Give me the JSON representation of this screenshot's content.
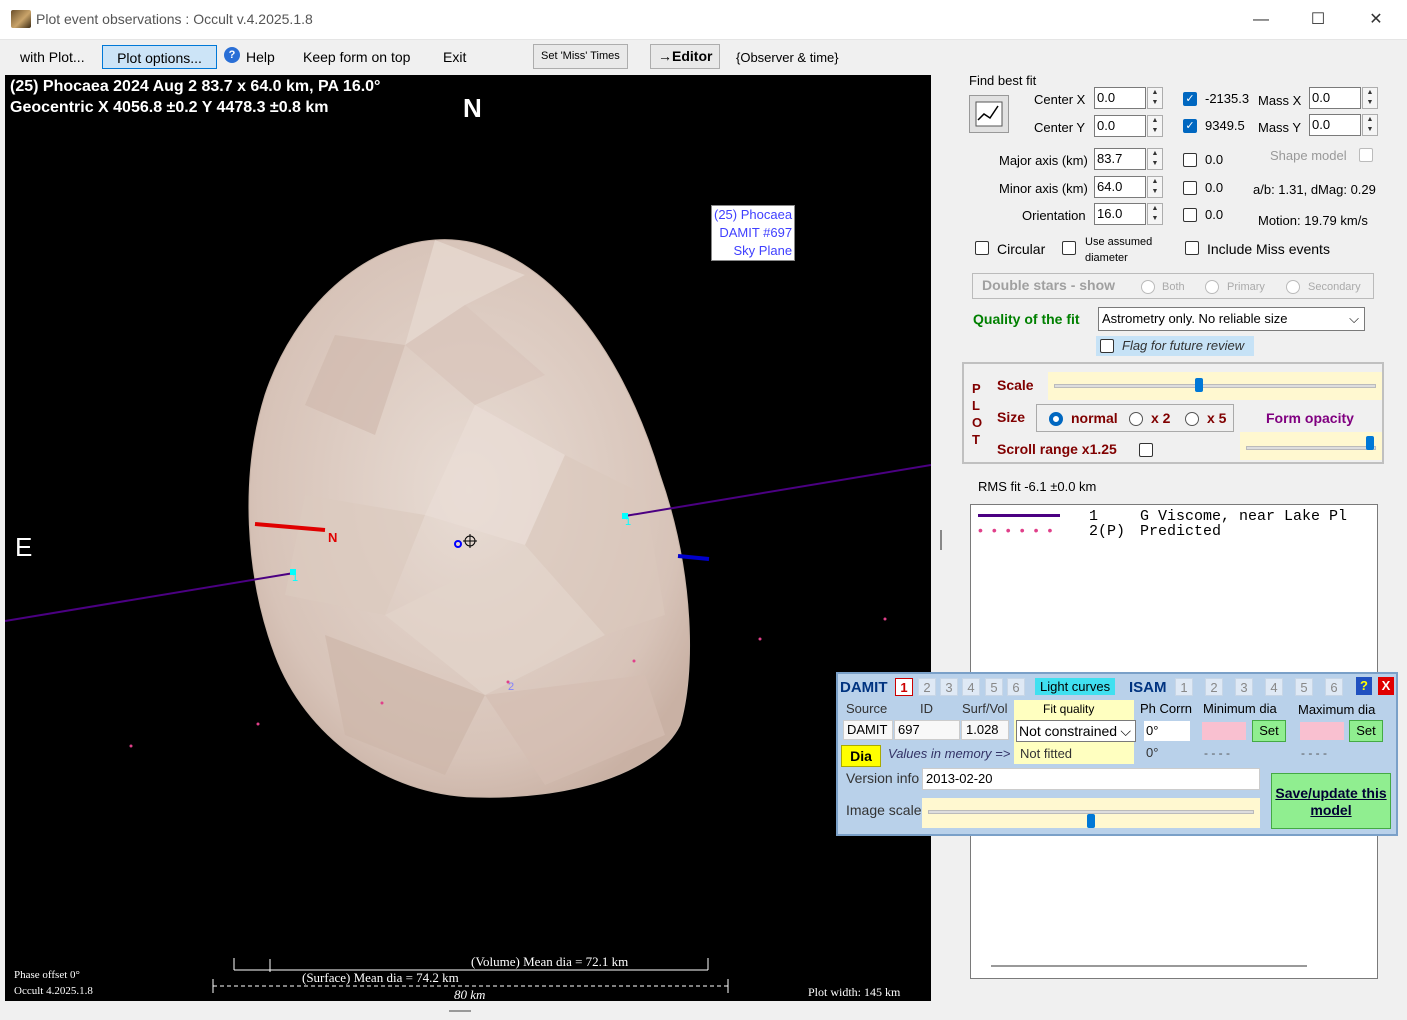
{
  "window": {
    "title": "Plot event observations : Occult v.4.2025.1.8",
    "minimize": "—",
    "maximize": "☐",
    "close": "✕"
  },
  "menu": {
    "with_plot": "with Plot...",
    "plot_options": "Plot options...",
    "help": "Help",
    "keep_on_top": "Keep form on top",
    "exit": "Exit",
    "set_miss_times": "Set 'Miss' Times",
    "editor": "→Editor",
    "observer_time": "{Observer & time}"
  },
  "plot": {
    "header_line1": "(25) Phocaea  2024 Aug 2  83.7 x 64.0 km, PA 16.0°",
    "header_line2": "Geocentric  X  4056.8 ±0.2  Y 4478.3 ±0.8 km",
    "north": "N",
    "east": "E",
    "model_label": [
      "(25) Phocaea",
      "DAMIT #697",
      "Sky Plane"
    ],
    "n_marker": "N",
    "chord1_label": "1",
    "chord2_label": "1",
    "point2_label": "2",
    "volume_dia": "(Volume) Mean dia = 72.1 km",
    "surface_dia": "(Surface) Mean dia = 74.2 km",
    "scale_bar": "80 km",
    "phase_offset": "Phase offset 0°",
    "version": "Occult 4.2025.1.8",
    "plot_width": "Plot width: 145 km"
  },
  "fit": {
    "find_best_fit": "Find best fit",
    "center_x_label": "Center X",
    "center_x": "0.0",
    "center_y_label": "Center Y",
    "center_y": "0.0",
    "cx_value": "-2135.3",
    "cy_value": "9349.5",
    "mass_x_label": "Mass X",
    "mass_x": "0.0",
    "mass_y_label": "Mass Y",
    "mass_y": "0.0",
    "major_label": "Major axis (km)",
    "major": "83.7",
    "major_chk": "0.0",
    "minor_label": "Minor axis (km)",
    "minor": "64.0",
    "minor_chk": "0.0",
    "orient_label": "Orientation",
    "orient": "16.0",
    "orient_chk": "0.0",
    "shape_model": "Shape model",
    "ab_dmag": "a/b: 1.31, dMag: 0.29",
    "motion": "Motion: 19.79 km/s",
    "circular": "Circular",
    "use_assumed": "Use assumed diameter",
    "include_miss": "Include Miss events"
  },
  "double_stars": {
    "label": "Double stars - show",
    "both": "Both",
    "primary": "Primary",
    "secondary": "Secondary"
  },
  "quality": {
    "label": "Quality of the fit",
    "value": "Astrometry only. No reliable size",
    "flag": "Flag for future review"
  },
  "plotbox": {
    "vertical": "P\nL\nO\nT",
    "scale": "Scale",
    "size": "Size",
    "normal": "normal",
    "x2": "x 2",
    "x5": "x 5",
    "form_opacity": "Form opacity",
    "scroll_range": "Scroll range x1.25",
    "scale_value": 0.45,
    "opacity_value": 0.95
  },
  "rms": "RMS fit -6.1 ±0.0 km",
  "observers": [
    {
      "num": "1",
      "name": "G Viscome, near Lake Pl",
      "color": "#4b0082"
    },
    {
      "num": "2(P)",
      "name": "Predicted",
      "color": "#e0408a"
    }
  ],
  "damit": {
    "title": "DAMIT",
    "tabs": [
      "1",
      "2",
      "3",
      "4",
      "5",
      "6"
    ],
    "light_curves": "Light curves",
    "isam": "ISAM",
    "isam_tabs": [
      "1",
      "2",
      "3",
      "4",
      "5",
      "6"
    ],
    "help": "?",
    "close": "X",
    "source_label": "Source",
    "id_label": "ID",
    "surfvol_label": "Surf/Vol",
    "fit_quality_label": "Fit quality",
    "ph_corrn_label": "Ph Corrn",
    "min_dia_label": "Minimum dia",
    "max_dia_label": "Maximum dia",
    "source": "DAMIT",
    "id": "697",
    "surfvol": "1.028",
    "fit_quality": "Not constrained",
    "ph_corrn": "0°",
    "not_fitted": "Not fitted",
    "ph_corrn2": "0°",
    "dia": "Dia",
    "values_in_memory": "Values in memory =>",
    "min_dashes": "- - - -",
    "max_dashes": "- - - -",
    "set": "Set",
    "version_info_label": "Version info",
    "version_info": "2013-02-20",
    "image_scale_label": "Image scale",
    "save_update": "Save/update this model",
    "image_scale_value": 0.5
  }
}
